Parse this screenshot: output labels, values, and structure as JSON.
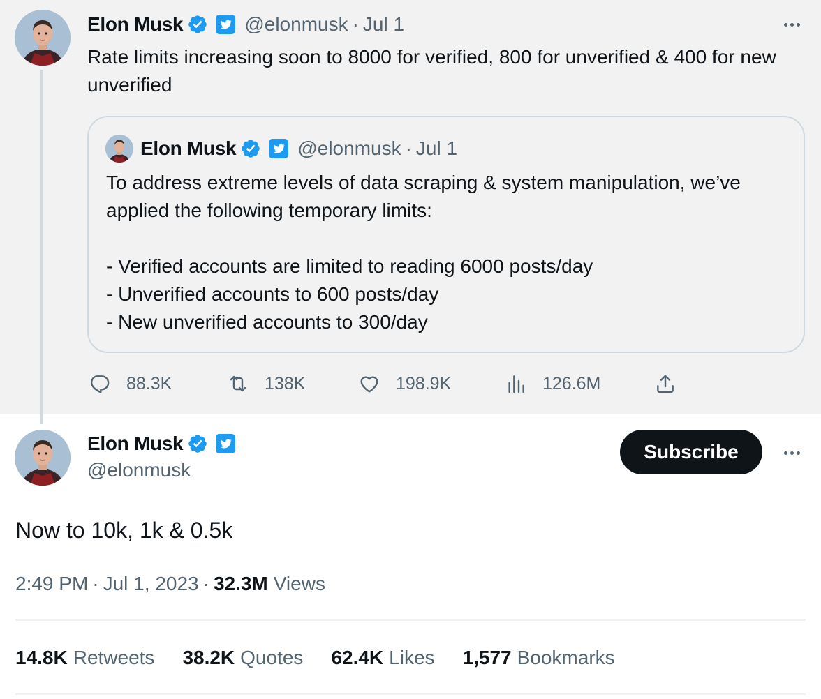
{
  "colors": {
    "verified_badge": "#1d9bf0",
    "twitter_square": "#1d9bf0",
    "parent_background": "#f2f2f2",
    "secondary_text": "#536471",
    "subscribe_button": "#0f1419"
  },
  "parent_tweet": {
    "author_name": "Elon Musk",
    "handle": "@elonmusk",
    "separator": "·",
    "date": "Jul 1",
    "text": "Rate limits increasing soon to 8000 for verified, 800 for unverified & 400 for new unverified",
    "quoted_tweet": {
      "author_name": "Elon Musk",
      "handle": "@elonmusk",
      "separator": "·",
      "date": "Jul 1",
      "text_lines": [
        "To address extreme levels of data scraping & system manipulation, we’ve applied the following temporary limits:",
        "",
        "- Verified accounts are limited to reading 6000 posts/day",
        "- Unverified accounts to 600 posts/day",
        "- New unverified accounts to 300/day"
      ]
    },
    "actions": {
      "replies": "88.3K",
      "retweets": "138K",
      "likes": "198.9K",
      "views": "126.6M"
    },
    "icons": [
      "verified-badge-icon",
      "twitter-square-icon",
      "more-icon",
      "reply-icon",
      "retweet-icon",
      "like-icon",
      "views-icon",
      "share-icon"
    ]
  },
  "main_tweet": {
    "author_name": "Elon Musk",
    "handle": "@elonmusk",
    "subscribe_label": "Subscribe",
    "text": "Now to 10k, 1k & 0.5k",
    "time": "2:49 PM",
    "date": "Jul 1, 2023",
    "separator": "·",
    "views_count": "32.3M",
    "views_label": "Views",
    "stats": [
      {
        "count": "14.8K",
        "label": "Retweets"
      },
      {
        "count": "38.2K",
        "label": "Quotes"
      },
      {
        "count": "62.4K",
        "label": "Likes"
      },
      {
        "count": "1,577",
        "label": "Bookmarks"
      }
    ]
  }
}
